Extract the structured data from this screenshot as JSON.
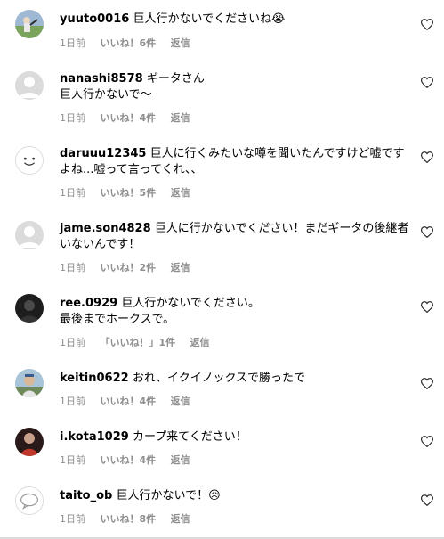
{
  "comments": [
    {
      "username": "yuuto0016",
      "text": "巨人行かないでくださいね😭",
      "time": "1日前",
      "likes": "いいね！6件",
      "reply": "返信",
      "avatar": "photo-baseball-avatar"
    },
    {
      "username": "nanashi8578",
      "text": "ギータさん\n巨人行かないで〜",
      "time": "1日前",
      "likes": "いいね！4件",
      "reply": "返信",
      "avatar": "default-user-avatar"
    },
    {
      "username": "daruuu12345",
      "text": "巨人に行くみたいな噂を聞いたんですけど嘘ですよね...嘘って言ってくれ、、",
      "time": "1日前",
      "likes": "いいね！5件",
      "reply": "返信",
      "avatar": "smile-face-avatar"
    },
    {
      "username": "jame.son4828",
      "text": "巨人に行かないでください！まだギータの後継者いないんです！",
      "time": "1日前",
      "likes": "いいね！2件",
      "reply": "返信",
      "avatar": "default-user-avatar"
    },
    {
      "username": "ree.0929",
      "text": "巨人行かないでください。\n最後までホークスで。",
      "time": "1日前",
      "likes": "「いいね！」1件",
      "reply": "返信",
      "avatar": "photo-dark-avatar"
    },
    {
      "username": "keitin0622",
      "text": "おれ、イクイノックスで勝ったで",
      "time": "1日前",
      "likes": "いいね！4件",
      "reply": "返信",
      "avatar": "photo-person-avatar"
    },
    {
      "username": "i.kota1029",
      "text": "カープ来てください！",
      "time": "1日前",
      "likes": "いいね！4件",
      "reply": "返信",
      "avatar": "photo-red-avatar"
    },
    {
      "username": "taito_ob",
      "text": "巨人行かないで！😥",
      "time": "1日前",
      "likes": "いいね！8件",
      "reply": "返信",
      "avatar": "bubble-avatar"
    }
  ],
  "colors": {
    "meta": "#8e8e8e",
    "border": "#dbdbdb"
  },
  "icons": {
    "like": "heart-outline-icon"
  }
}
